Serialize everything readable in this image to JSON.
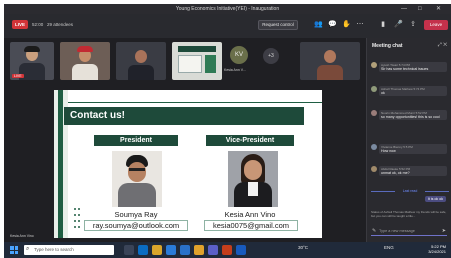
{
  "window": {
    "title": "Young Economics Initiative(YEI) - Inauguration",
    "controls": [
      "—",
      "□",
      "✕"
    ]
  },
  "toolbar": {
    "live_label": "LIVE",
    "timer": "52:00",
    "attendees": "29 attendees",
    "request_control_label": "Request control",
    "leave_label": "Leave",
    "icons": [
      "people-icon",
      "chat-icon",
      "raise-hand-icon",
      "more-icon",
      "camera-icon",
      "mic-icon",
      "share-icon"
    ]
  },
  "participants": {
    "tiles": [
      {
        "label": "LIVE"
      },
      {
        "label": ""
      },
      {
        "label": ""
      },
      {
        "label": ""
      }
    ],
    "kav": {
      "initials": "KV",
      "name": "Kesia Ann V..."
    },
    "more": "+3"
  },
  "slide": {
    "heading": "Contact us!",
    "people": [
      {
        "role": "President",
        "name": "Soumya Ray",
        "email": "ray.soumya@outlook.com"
      },
      {
        "role": "Vice-President",
        "name": "Kesia Ann Vino",
        "email": "kesia0075@gmail.com"
      }
    ],
    "presenter_label": "Kesia Ann Vino"
  },
  "chat": {
    "title": "Meeting chat",
    "messages": [
      {
        "meta": "Ayush Tiwari  5:74 PM",
        "text": "Sir has some technical issues"
      },
      {
        "meta": "Ashwil Thomas Mathew  5:74 PM",
        "text": "ok"
      },
      {
        "meta": "Noorin Mohammed Munir  5:52 PM",
        "text": "so many opportunities! this is so cool"
      },
      {
        "meta": "Vivianne Bienny  5:5 PM",
        "text": "How now"
      },
      {
        "meta": "Abdul Rauke  5:52 PM",
        "text": "unmat ok, ok me?"
      }
    ],
    "last_read": "Last read",
    "own_message": "It is ok ok",
    "system_note": "Status of Ashwil Thomas Mathew my friends will be safe, but you can still be taught a litle...",
    "compose_placeholder": "Type a new message"
  },
  "taskbar": {
    "search_placeholder": "Type here to search",
    "weather": "30°C",
    "language": "ENG",
    "time": "5:22 PM",
    "date": "3/24/2021"
  },
  "colors": {
    "slide_green": "#1e4a3a",
    "live_red": "#d13438",
    "leave_red": "#c4314b"
  }
}
